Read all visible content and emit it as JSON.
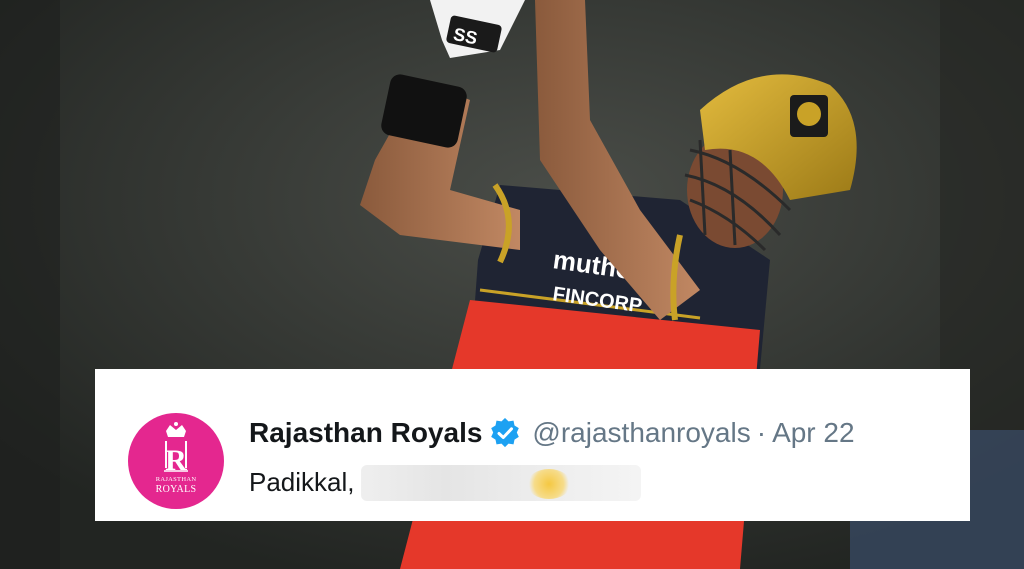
{
  "tweet": {
    "display_name": "Rajasthan Royals",
    "handle": "@rajasthanroyals",
    "separator": "·",
    "date": "Apr 22",
    "text_visible": "Padikkal,",
    "verified": true,
    "avatar": {
      "background_color": "#e4278f",
      "line1": "RAJASTHAN",
      "line2": "ROYALS",
      "emblem": "crown-crest-icon"
    }
  },
  "photo": {
    "subject": "cricket-batsman",
    "helmet_color": "#c9a227",
    "jersey_colors": [
      "#1f2433",
      "#e5382a"
    ],
    "jersey_text": [
      "muthoot",
      "FINCORP"
    ],
    "glove_text": "SS"
  },
  "colors": {
    "verified_blue": "#1da1f2",
    "muted_text": "#657786",
    "primary_text": "#14171a"
  }
}
